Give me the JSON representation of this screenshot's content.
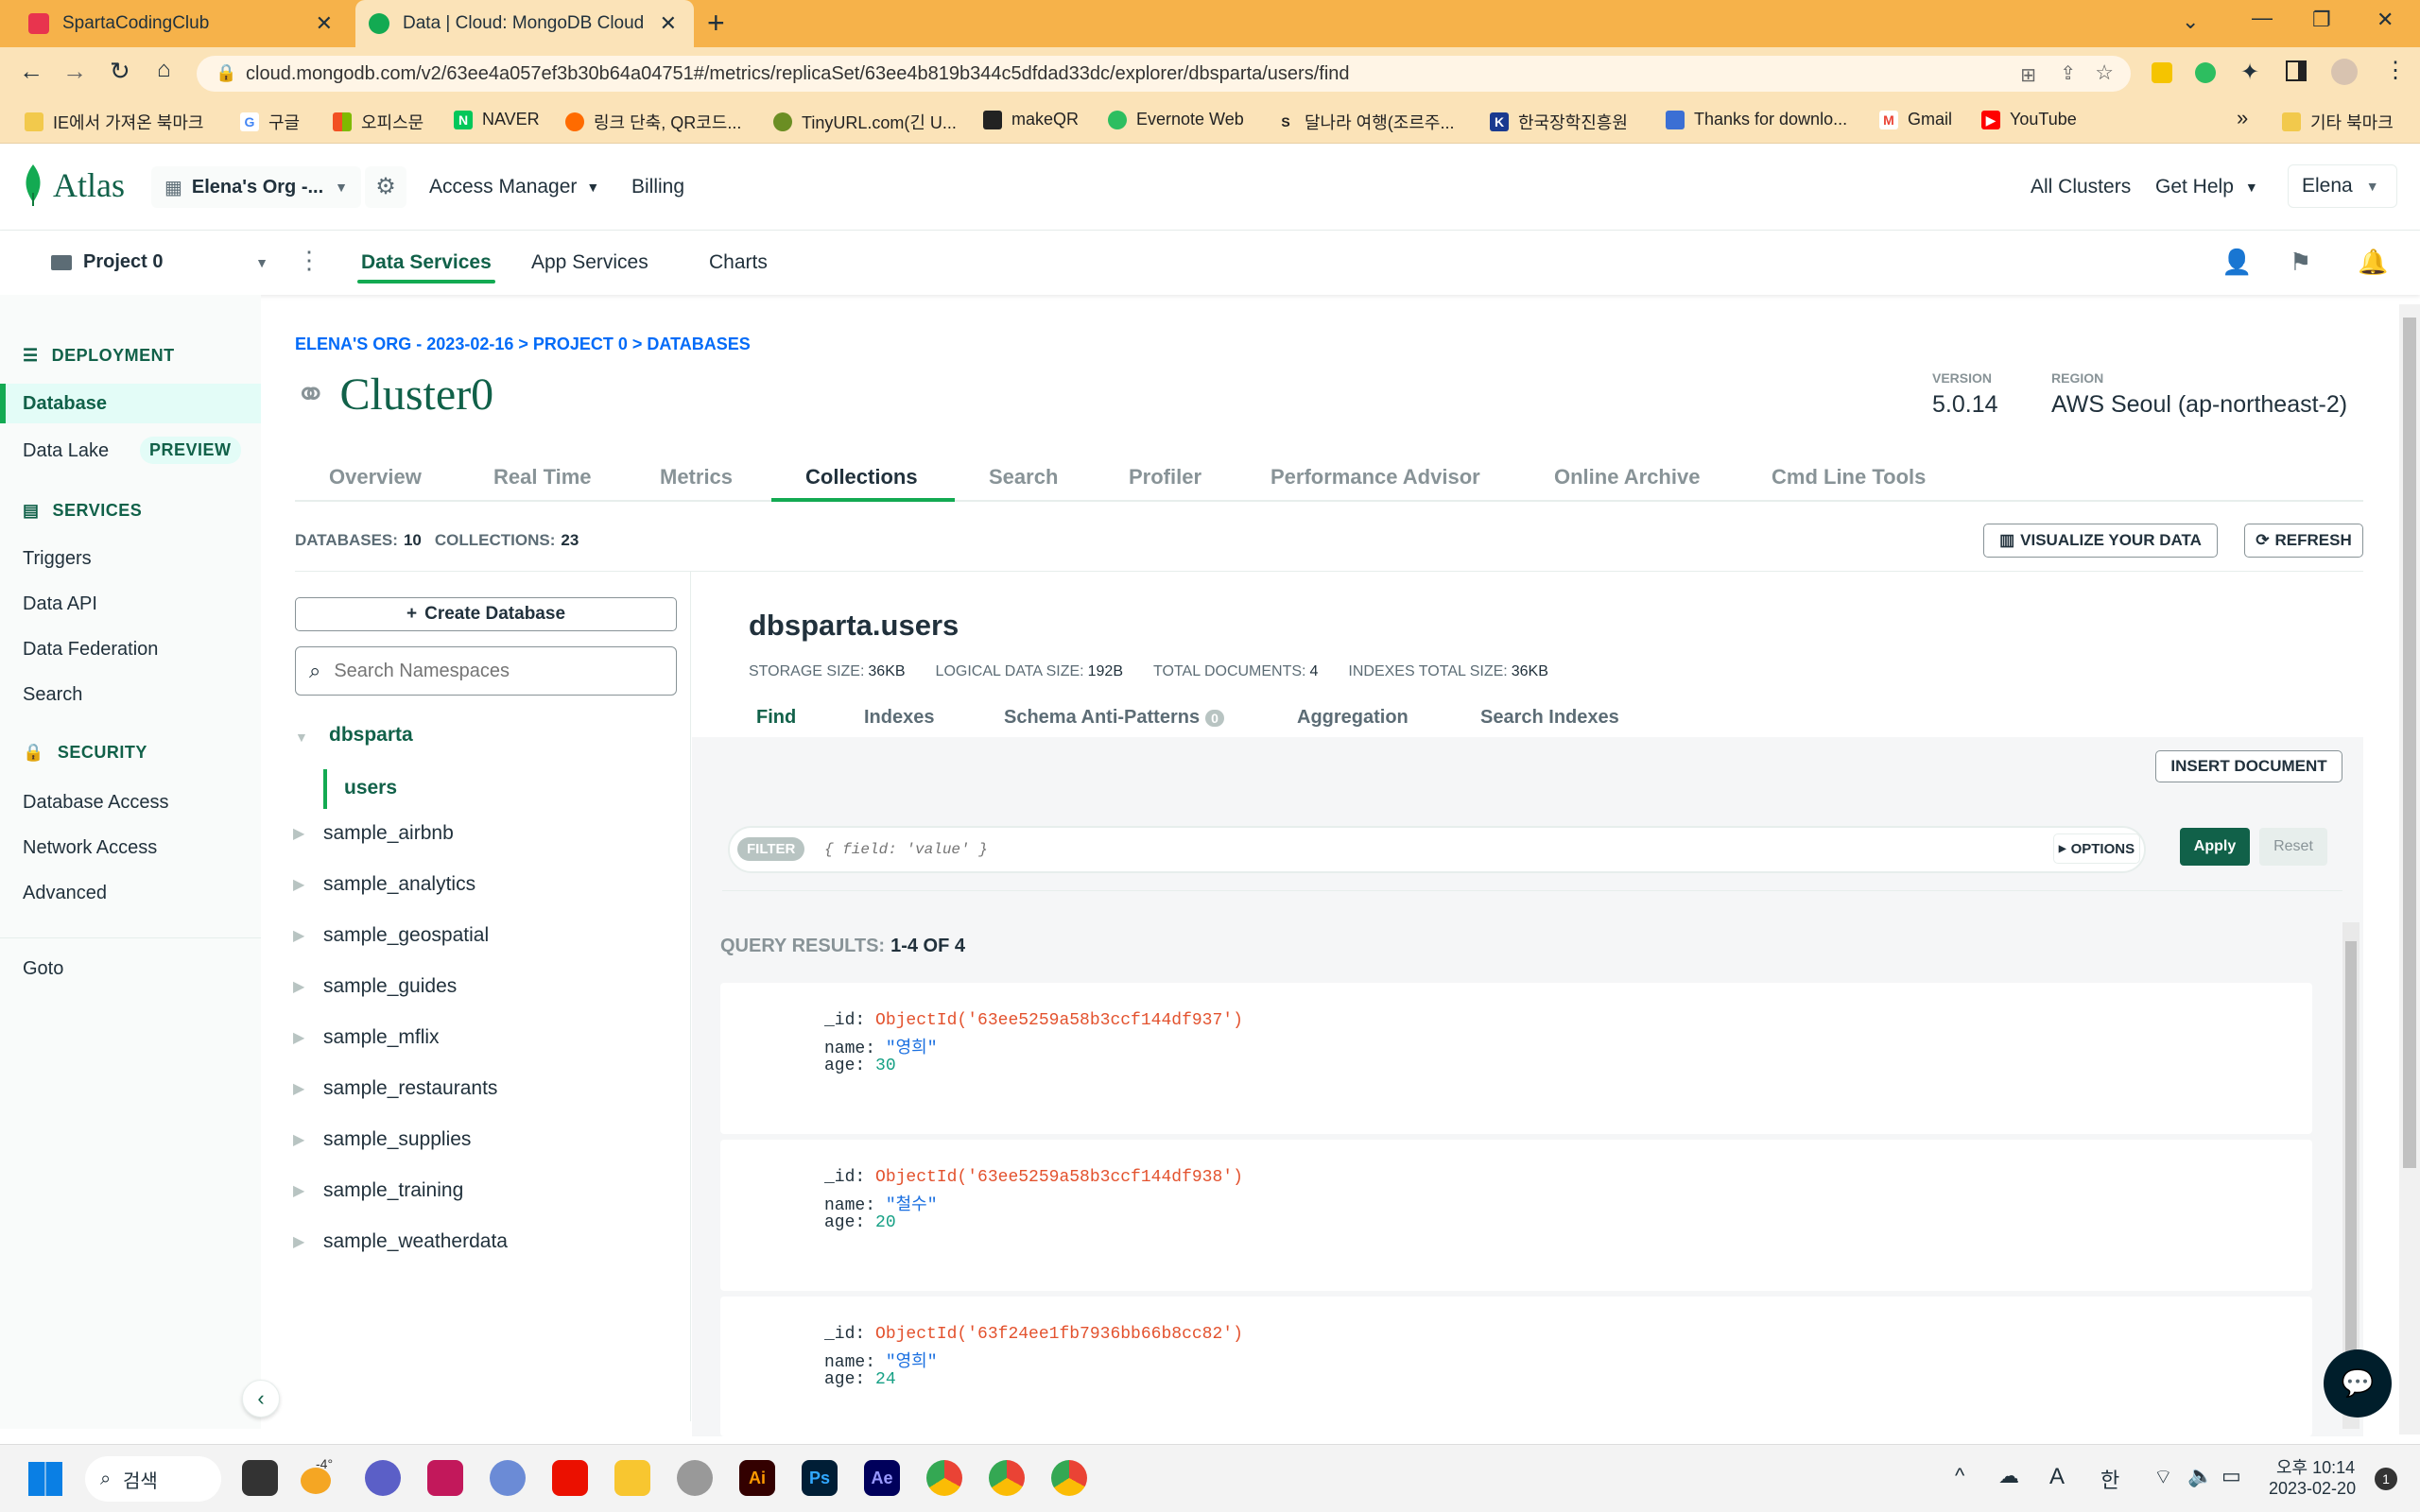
{
  "browser": {
    "tabs": [
      {
        "title": "SpartaCodingClub",
        "active": false
      },
      {
        "title": "Data | Cloud: MongoDB Cloud",
        "active": true
      }
    ],
    "new_tab": "+",
    "url": "cloud.mongodb.com/v2/63ee4a057ef3b30b64a04751#/metrics/replicaSet/63ee4b819b344c5dfdad33dc/explorer/dbsparta/users/find",
    "bookmarks": [
      {
        "label": "IE에서 가져온 북마크",
        "icon": "folder-icon"
      },
      {
        "label": "구글",
        "icon": "google-icon"
      },
      {
        "label": "오피스문",
        "icon": "office-icon"
      },
      {
        "label": "NAVER",
        "icon": "naver-icon"
      },
      {
        "label": "링크 단축, QR코드...",
        "icon": "link-icon"
      },
      {
        "label": "TinyURL.com(긴 U...",
        "icon": "tinyurl-icon"
      },
      {
        "label": "makeQR",
        "icon": "qr-icon"
      },
      {
        "label": "Evernote Web",
        "icon": "evernote-icon"
      },
      {
        "label": "달나라 여행(조르주...",
        "icon": "s-icon"
      },
      {
        "label": "한국장학진흥원",
        "icon": "k-icon"
      },
      {
        "label": "Thanks for downlo...",
        "icon": "chart-icon"
      },
      {
        "label": "Gmail",
        "icon": "gmail-icon"
      },
      {
        "label": "YouTube",
        "icon": "youtube-icon"
      }
    ],
    "bookmarks_more": "»",
    "other_bookmarks": "기타 북마크"
  },
  "atlas": {
    "logo": "Atlas",
    "org": "Elena's Org -...",
    "access_manager": "Access Manager",
    "billing": "Billing",
    "all_clusters": "All Clusters",
    "get_help": "Get Help",
    "user": "Elena",
    "project": "Project 0",
    "nav": [
      "Data Services",
      "App Services",
      "Charts"
    ]
  },
  "sidebar": {
    "deployment": "DEPLOYMENT",
    "database": "Database",
    "data_lake": "Data Lake",
    "preview": "PREVIEW",
    "services": "SERVICES",
    "triggers": "Triggers",
    "data_api": "Data API",
    "data_federation": "Data Federation",
    "search": "Search",
    "security": "SECURITY",
    "database_access": "Database Access",
    "network_access": "Network Access",
    "advanced": "Advanced",
    "goto": "Goto"
  },
  "cluster": {
    "breadcrumb": "ELENA'S ORG - 2023-02-16 > PROJECT 0 > DATABASES",
    "name": "Cluster0",
    "version_label": "VERSION",
    "version": "5.0.14",
    "region_label": "REGION",
    "region": "AWS Seoul (ap-northeast-2)",
    "tabs": [
      "Overview",
      "Real Time",
      "Metrics",
      "Collections",
      "Search",
      "Profiler",
      "Performance Advisor",
      "Online Archive",
      "Cmd Line Tools"
    ]
  },
  "stats": {
    "databases_label": "DATABASES:",
    "databases": "10",
    "collections_label": "COLLECTIONS:",
    "collections": "23",
    "visualize": "VISUALIZE YOUR DATA",
    "refresh": "REFRESH"
  },
  "namespaces": {
    "create_db": "Create Database",
    "search_placeholder": "Search Namespaces",
    "active_db": "dbsparta",
    "active_collection": "users",
    "databases": [
      "sample_airbnb",
      "sample_analytics",
      "sample_geospatial",
      "sample_guides",
      "sample_mflix",
      "sample_restaurants",
      "sample_supplies",
      "sample_training",
      "sample_weatherdata"
    ]
  },
  "collection": {
    "title": "dbsparta.users",
    "storage_label": "STORAGE SIZE:",
    "storage": "36KB",
    "logical_label": "LOGICAL DATA SIZE:",
    "logical": "192B",
    "total_docs_label": "TOTAL DOCUMENTS:",
    "total_docs": "4",
    "indexes_label": "INDEXES TOTAL SIZE:",
    "indexes": "36KB",
    "subtabs": [
      "Find",
      "Indexes",
      "Schema Anti-Patterns",
      "Aggregation",
      "Search Indexes"
    ],
    "anti_pattern_count": "0",
    "insert": "INSERT DOCUMENT",
    "filter_label": "FILTER",
    "filter_placeholder": "{ field: 'value' }",
    "options": "OPTIONS",
    "apply": "Apply",
    "reset": "Reset",
    "results_label": "QUERY RESULTS:",
    "results_range": "1-4 OF 4",
    "documents": [
      {
        "id": "ObjectId('63ee5259a58b3ccf144df937')",
        "name": "\"영희\"",
        "age": "30"
      },
      {
        "id": "ObjectId('63ee5259a58b3ccf144df938')",
        "name": "\"철수\"",
        "age": "20"
      },
      {
        "id": "ObjectId('63f24ee1fb7936bb66b8cc82')",
        "name": "\"영희\"",
        "age": "24"
      }
    ]
  },
  "taskbar": {
    "search": "검색",
    "weather": "-4°",
    "time": "오후 10:14",
    "date": "2023-02-20",
    "lang": "한",
    "ime": "A",
    "notif": "1"
  }
}
